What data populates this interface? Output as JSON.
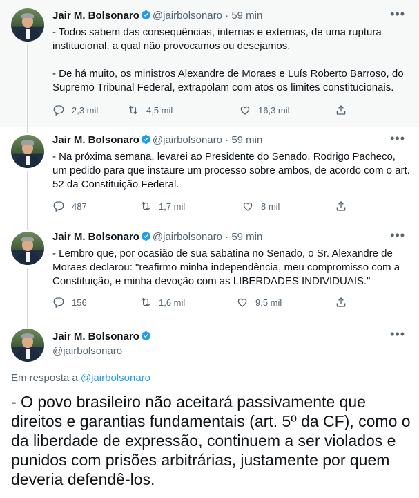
{
  "author": {
    "name": "Jair M. Bolsonaro",
    "handle": "@jairbolsonaro",
    "verified_color": "#1d9bf0"
  },
  "tweets": [
    {
      "time": "· 59 min",
      "text": "- Todos sabem das consequências, internas e externas, de uma ruptura institucional, a qual não provocamos ou desejamos.\n\n- De há muito, os ministros Alexandre de Moraes e Luís Roberto Barroso, do Supremo Tribunal Federal, extrapolam com atos os limites constitucionais.",
      "replies": "2,3 mil",
      "retweets": "4,5 mil",
      "likes": "16,3 mil"
    },
    {
      "time": "· 59 min",
      "text": "- Na próxima semana, levarei ao Presidente do Senado, Rodrigo Pacheco, um pedido para que instaure um processo sobre ambos, de acordo com o art. 52 da Constituição Federal.",
      "replies": "487",
      "retweets": "1,7 mil",
      "likes": "8 mil"
    },
    {
      "time": "· 59 min",
      "text": "- Lembro que, por ocasião de sua sabatina no Senado, o Sr. Alexandre de Moraes declarou: \"reafirmo minha independência, meu compromisso com a Constituição, e minha devoção com as LIBERDADES INDIVIDUAIS.\"",
      "replies": "156",
      "retweets": "1,6 mil",
      "likes": "9,5 mil"
    }
  ],
  "main_tweet": {
    "reply_prefix": "Em resposta a",
    "reply_to": "@jairbolsonaro",
    "text": "- O povo brasileiro não aceitará passivamente que direitos e garantias fundamentais (art. 5º da CF), como o da liberdade de expressão, continuem a ser violados e punidos com prisões arbitrárias, justamente por quem deveria defendê-los."
  },
  "icons": {
    "reply": "reply-icon",
    "retweet": "retweet-icon",
    "like": "heart-icon",
    "share": "share-icon",
    "more": "more-icon",
    "verified": "verified-badge-icon"
  }
}
